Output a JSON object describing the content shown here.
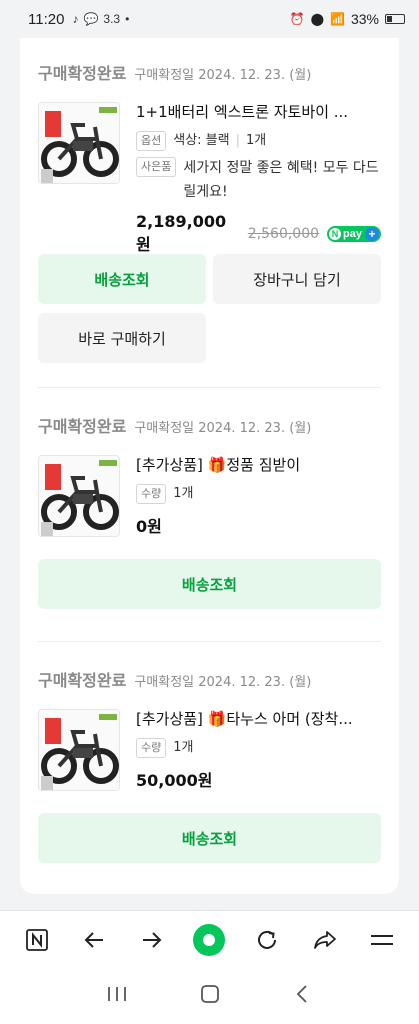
{
  "statusbar": {
    "time": "11:20",
    "notif_count": "3.3",
    "battery": "33%"
  },
  "orders": [
    {
      "status": "구매확정완료",
      "confirm_date": "구매확정일 2024. 12. 23. (월)",
      "product_name": "1+1배터리 엑스트론 자토바이 ...",
      "option_tag": "옵션",
      "option_text": "색상: 블랙",
      "quantity": "1개",
      "gift_tag": "사은품",
      "gift_text": "세가지 정말 좋은 혜택! 모두 다드릴게요!",
      "price": "2,189,000원",
      "original_price": "2,560,000",
      "npay_label": "pay",
      "buttons": [
        "배송조회",
        "장바구니 담기",
        "바로 구매하기"
      ]
    },
    {
      "status": "구매확정완료",
      "confirm_date": "구매확정일 2024. 12. 23. (월)",
      "product_name": "[추가상품] 🎁정품 짐받이",
      "qty_tag": "수량",
      "quantity": "1개",
      "price": "0원",
      "buttons": [
        "배송조회"
      ]
    },
    {
      "status": "구매확정완료",
      "confirm_date": "구매확정일 2024. 12. 23. (월)",
      "product_name": "[추가상품] 🎁타누스 아머 (장착...",
      "qty_tag": "수량",
      "quantity": "1개",
      "price": "50,000원",
      "buttons": [
        "배송조회"
      ]
    }
  ],
  "browser_nav": [
    "naver-n-icon",
    "back-arrow-icon",
    "forward-arrow-icon",
    "home-green-icon",
    "refresh-icon",
    "share-icon",
    "menu-icon"
  ],
  "colors": {
    "accent_green": "#03c75a",
    "button_green_text": "#07a13f",
    "button_green_bg": "#e6f8ec",
    "npay_plus_blue": "#1e88e5"
  }
}
